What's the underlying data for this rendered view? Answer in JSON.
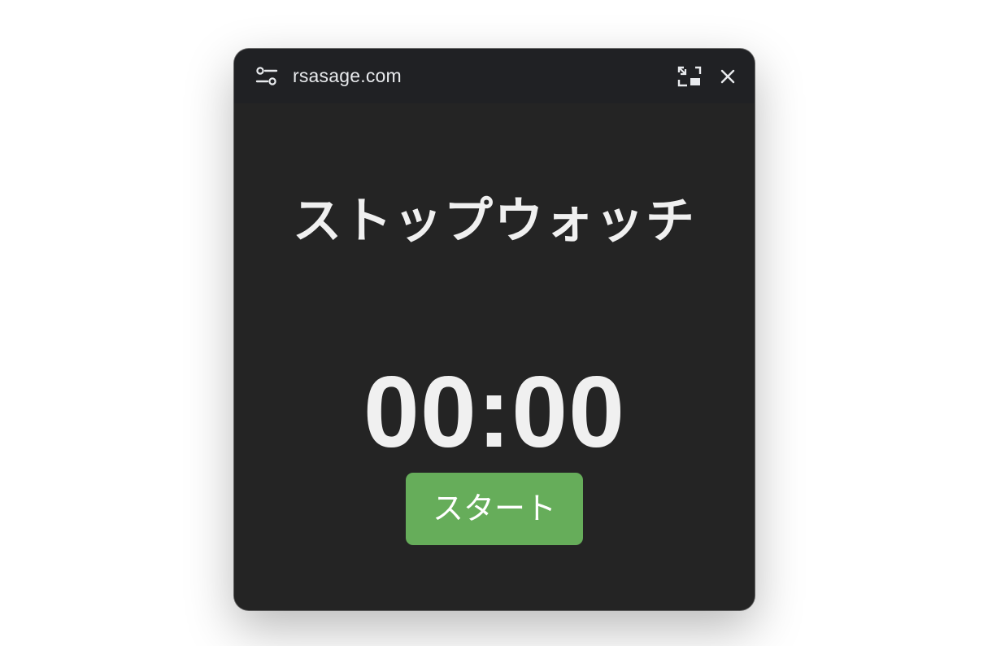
{
  "window": {
    "site_title": "rsasage.com",
    "icons": {
      "settings": "settings-sliders-icon",
      "back_to_tab": "back-to-tab-icon",
      "close": "close-icon"
    }
  },
  "main": {
    "heading": "ストップウォッチ",
    "timer_display": "00:00",
    "start_label": "スタート"
  },
  "colors": {
    "window_bg": "#242424",
    "titlebar_bg": "#202124",
    "text": "#f0f0f0",
    "start_button": "#66ad5a"
  }
}
